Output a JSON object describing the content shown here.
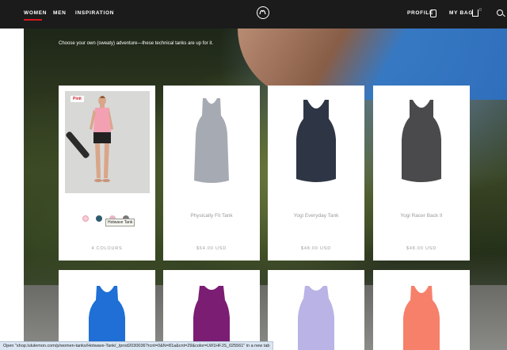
{
  "nav": {
    "links": [
      "WOMEN",
      "MEN",
      "INSPIRATION"
    ],
    "profile": "PROFILE",
    "bag": "MY BAG",
    "bag_count": "0"
  },
  "hero": {
    "intro": "Choose your own (sweaty) adventure—these technical tanks are up for it."
  },
  "products": [
    {
      "name": "",
      "price": "4 COLOURS",
      "pin_label": "Pinit",
      "tooltip": "Hotwave Tank",
      "swatch_colors": [
        "#f2a7b8",
        "#2f5b70",
        "#e8b7c2",
        "#7a7a7a"
      ],
      "color": "#f4a0b3"
    },
    {
      "name": "Physically Fit Tank",
      "price": "$64.00 USD",
      "color": "#a6abb3"
    },
    {
      "name": "Yogi Everyday Tank",
      "price": "$48.00 USD",
      "color": "#2e3645"
    },
    {
      "name": "Yogi Racer Back II",
      "price": "$48.00 USD",
      "color": "#4a4a4c"
    }
  ],
  "row2_colors": [
    "#1f6fd6",
    "#7b1d73",
    "#b9b3e6",
    "#f7806a"
  ],
  "status_bar": "Open \"shop.lululemon.com/p/women-tanks/Hotwave-Tank/_/prod2030036?rcnt=0&N=81a&cnt=29&color=LW1HFJS_025561\" in a new tab"
}
